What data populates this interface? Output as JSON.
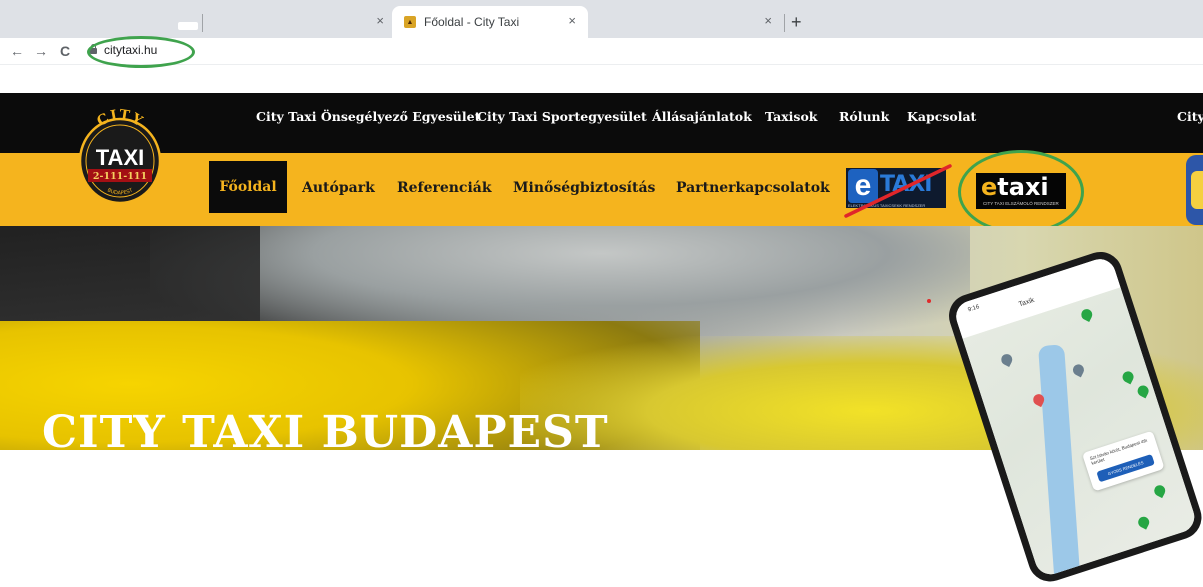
{
  "browser": {
    "tabs": [
      {
        "label": "",
        "active": false
      },
      {
        "label": "",
        "active": false
      },
      {
        "label": "Főoldal - City Taxi",
        "active": true
      },
      {
        "label": "",
        "active": false
      }
    ],
    "tab_close_glyph": "×",
    "new_tab_glyph": "+",
    "nav": {
      "back": "←",
      "forward": "→",
      "reload": "C"
    },
    "url": "citytaxi.hu"
  },
  "site": {
    "logo": {
      "top": "CITY",
      "middle": "TAXI",
      "phone": "2-111-111",
      "bottom": "BUDAPEST"
    },
    "top_nav": [
      "City Taxi Önsegélyező Egyesület",
      "City Taxi Sportegyesület",
      "Állásajánlatok",
      "Taxisok",
      "Rólunk",
      "Kapcsolat"
    ],
    "top_nav_right": "City",
    "main_nav": [
      "Főoldal",
      "Autópark",
      "Referenciák",
      "Minőségbiztosítás",
      "Partnerkapcsolatok"
    ],
    "main_nav_active": "Főoldal",
    "etaxi_old": {
      "letter": "e",
      "word": "TAXI",
      "subtitle": "ELEKTRONIKUS TAXICSEKK RENDSZER"
    },
    "etaxi_new": {
      "letter": "e",
      "word": "taxi",
      "subtitle": "CITY TAXI ELSZÁMOLÓ RENDSZER"
    },
    "hero_title": "CITY TAXI BUDAPEST",
    "phone_app": {
      "time": "9:16",
      "title": "Taxik",
      "card_text": "Szt.István körút, Budapest 4th kerület",
      "card_button": "GYORS RENDELÉS"
    }
  },
  "colors": {
    "brand_yellow": "#f5b41e",
    "nav_black": "#0b0b0b",
    "annotation_green": "#3fa34d",
    "strike_red": "#e0262a"
  }
}
